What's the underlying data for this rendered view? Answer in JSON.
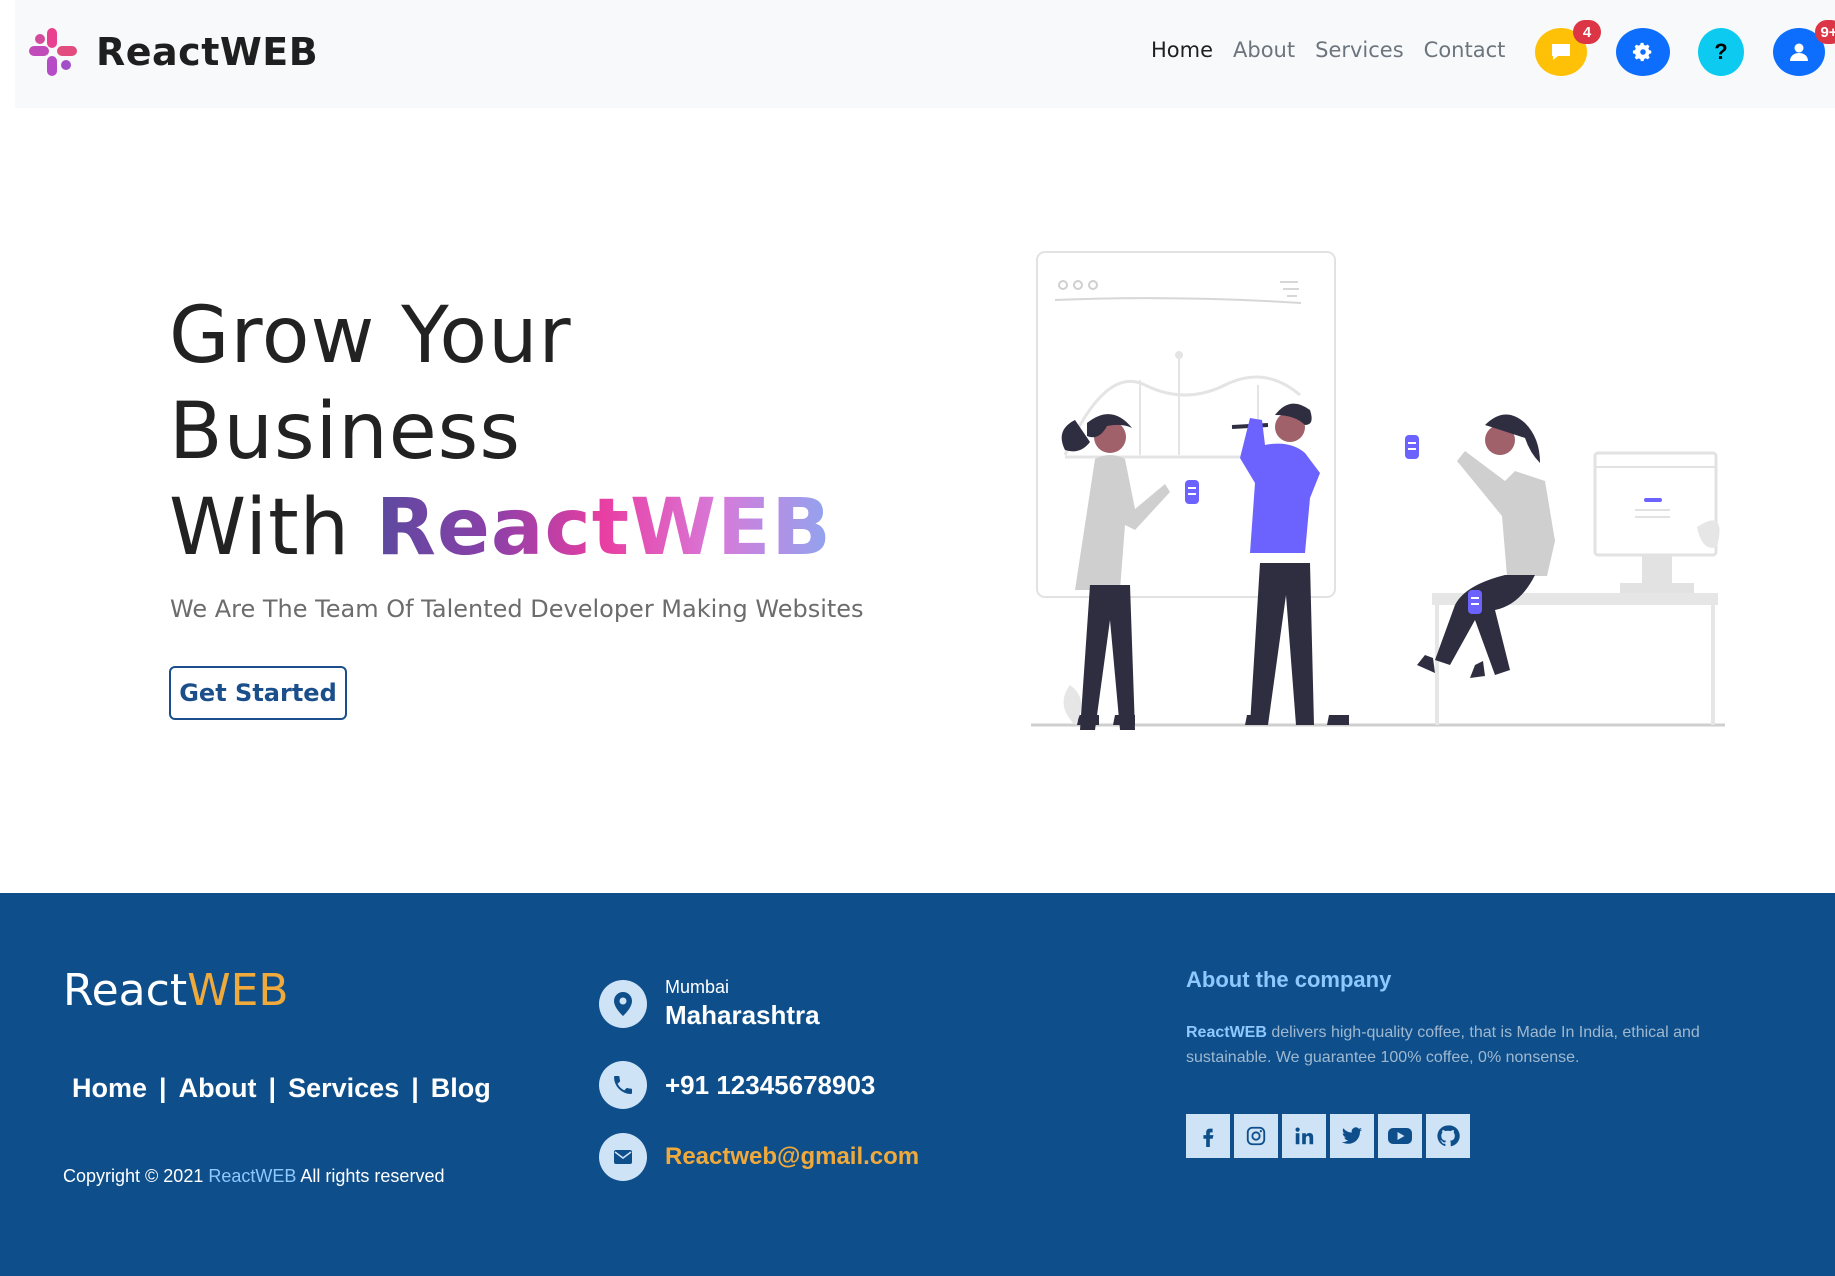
{
  "navbar": {
    "brand": "ReactWEB",
    "links": [
      "Home",
      "About",
      "Services",
      "Contact"
    ],
    "active_link": "Home",
    "icons": [
      {
        "name": "message-icon",
        "color": "#ffc107",
        "badge": "4"
      },
      {
        "name": "gear-icon",
        "color": "#0d6efd",
        "badge": ""
      },
      {
        "name": "question-icon",
        "color": "#0dcaf0",
        "badge": ""
      },
      {
        "name": "user-icon",
        "color": "#0d6efd",
        "badge": "9+"
      }
    ]
  },
  "hero": {
    "line1": "Grow Your",
    "line2": "Business",
    "line3_prefix": "With",
    "line3_brand": "ReactWEB",
    "subtitle": "We Are The Team Of Talented Developer Making Websites",
    "cta": "Get Started"
  },
  "footer": {
    "brand_part1": "React",
    "brand_part2": "WEB",
    "links": [
      "Home",
      "About",
      "Services",
      "Blog"
    ],
    "separator": "|",
    "copyright_prefix": "Copyright © 2021",
    "copyright_brand": "ReactWEB",
    "copyright_suffix": "All rights reserved",
    "contact": {
      "city": "Mumbai",
      "state": "Maharashtra",
      "phone": "+91 12345678903",
      "email": "Reactweb@gmail.com"
    },
    "about": {
      "heading": "About the company",
      "brand": "ReactWEB",
      "text": "delivers high-quality coffee, that is Made In India, ethical and sustainable. We guarantee 100% coffee, 0% nonsense."
    },
    "socials": [
      "facebook-icon",
      "instagram-icon",
      "linkedin-icon",
      "twitter-icon",
      "youtube-icon",
      "github-icon"
    ]
  },
  "colors": {
    "navbar_bg": "#f8f9fa",
    "footer_bg": "#0e4f8b",
    "accent_gold": "#f0a93b",
    "accent_light_blue": "#8ec8ff",
    "cta_border": "#1b4f8c",
    "illustration_purple": "#6c63ff"
  }
}
